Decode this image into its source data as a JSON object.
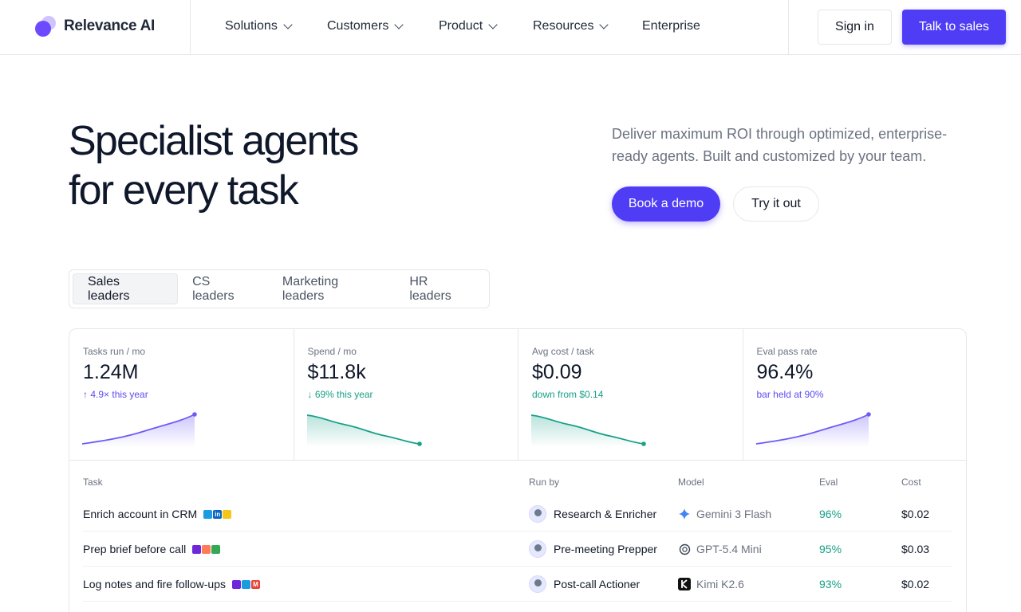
{
  "nav": {
    "brand": "Relevance AI",
    "menu": [
      {
        "label": "Solutions",
        "dropdown": true
      },
      {
        "label": "Customers",
        "dropdown": true
      },
      {
        "label": "Product",
        "dropdown": true
      },
      {
        "label": "Resources",
        "dropdown": true
      },
      {
        "label": "Enterprise",
        "dropdown": false
      }
    ],
    "sign_in": "Sign in",
    "talk_to_sales": "Talk to sales"
  },
  "hero": {
    "title_line1": "Specialist agents",
    "title_line2": "for every task",
    "subtitle": "Deliver maximum ROI through optimized, enterprise-ready agents. Built and customized by your team.",
    "primary_cta": "Book a demo",
    "secondary_cta": "Try it out"
  },
  "tabs": [
    {
      "label": "Sales leaders",
      "active": true
    },
    {
      "label": "CS leaders",
      "active": false
    },
    {
      "label": "Marketing leaders",
      "active": false
    },
    {
      "label": "HR leaders",
      "active": false
    }
  ],
  "stats": [
    {
      "label": "Tasks run / mo",
      "value": "1.24M",
      "delta": "↑ 4.9× this year",
      "tone": "purple",
      "trend": "up"
    },
    {
      "label": "Spend / mo",
      "value": "$11.8k",
      "delta": "↓ 69% this year",
      "tone": "green",
      "trend": "down"
    },
    {
      "label": "Avg cost / task",
      "value": "$0.09",
      "delta": "down from $0.14",
      "tone": "green",
      "trend": "down"
    },
    {
      "label": "Eval pass rate",
      "value": "96.4%",
      "delta": "bar held at 90%",
      "tone": "purple",
      "trend": "up"
    }
  ],
  "table": {
    "headers": {
      "task": "Task",
      "run_by": "Run by",
      "model": "Model",
      "eval": "Eval",
      "cost": "Cost"
    },
    "rows": [
      {
        "task": "Enrich account in CRM",
        "run_by": "Research & Enricher",
        "model": "Gemini 3 Flash",
        "model_icon": "gemini-icon",
        "eval": "96%",
        "cost": "$0.02"
      },
      {
        "task": "Prep brief before call",
        "run_by": "Pre-meeting Prepper",
        "model": "GPT-5.4 Mini",
        "model_icon": "openai-icon",
        "eval": "95%",
        "cost": "$0.03"
      },
      {
        "task": "Log notes and fire follow-ups",
        "run_by": "Post-call Actioner",
        "model": "Kimi K2.6",
        "model_icon": "kimi-icon",
        "eval": "93%",
        "cost": "$0.02"
      }
    ]
  },
  "colors": {
    "accent": "#4f3df5",
    "purple_series": "#6d5cf6",
    "green_series": "#17a08a"
  }
}
